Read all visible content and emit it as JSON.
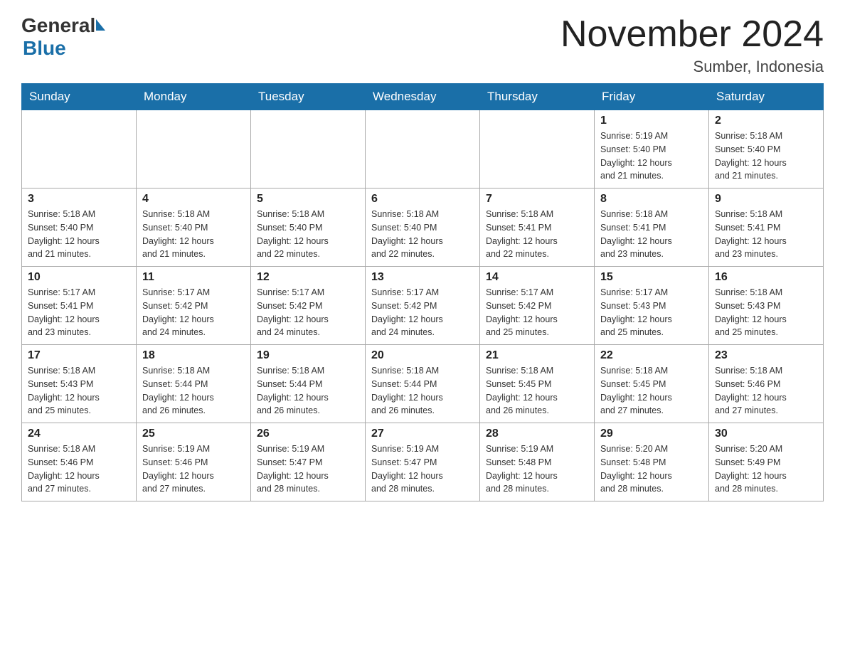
{
  "header": {
    "title": "November 2024",
    "location": "Sumber, Indonesia",
    "logo_general": "General",
    "logo_blue": "Blue"
  },
  "days_of_week": [
    "Sunday",
    "Monday",
    "Tuesday",
    "Wednesday",
    "Thursday",
    "Friday",
    "Saturday"
  ],
  "weeks": [
    [
      {
        "day": "",
        "info": ""
      },
      {
        "day": "",
        "info": ""
      },
      {
        "day": "",
        "info": ""
      },
      {
        "day": "",
        "info": ""
      },
      {
        "day": "",
        "info": ""
      },
      {
        "day": "1",
        "info": "Sunrise: 5:19 AM\nSunset: 5:40 PM\nDaylight: 12 hours\nand 21 minutes."
      },
      {
        "day": "2",
        "info": "Sunrise: 5:18 AM\nSunset: 5:40 PM\nDaylight: 12 hours\nand 21 minutes."
      }
    ],
    [
      {
        "day": "3",
        "info": "Sunrise: 5:18 AM\nSunset: 5:40 PM\nDaylight: 12 hours\nand 21 minutes."
      },
      {
        "day": "4",
        "info": "Sunrise: 5:18 AM\nSunset: 5:40 PM\nDaylight: 12 hours\nand 21 minutes."
      },
      {
        "day": "5",
        "info": "Sunrise: 5:18 AM\nSunset: 5:40 PM\nDaylight: 12 hours\nand 22 minutes."
      },
      {
        "day": "6",
        "info": "Sunrise: 5:18 AM\nSunset: 5:40 PM\nDaylight: 12 hours\nand 22 minutes."
      },
      {
        "day": "7",
        "info": "Sunrise: 5:18 AM\nSunset: 5:41 PM\nDaylight: 12 hours\nand 22 minutes."
      },
      {
        "day": "8",
        "info": "Sunrise: 5:18 AM\nSunset: 5:41 PM\nDaylight: 12 hours\nand 23 minutes."
      },
      {
        "day": "9",
        "info": "Sunrise: 5:18 AM\nSunset: 5:41 PM\nDaylight: 12 hours\nand 23 minutes."
      }
    ],
    [
      {
        "day": "10",
        "info": "Sunrise: 5:17 AM\nSunset: 5:41 PM\nDaylight: 12 hours\nand 23 minutes."
      },
      {
        "day": "11",
        "info": "Sunrise: 5:17 AM\nSunset: 5:42 PM\nDaylight: 12 hours\nand 24 minutes."
      },
      {
        "day": "12",
        "info": "Sunrise: 5:17 AM\nSunset: 5:42 PM\nDaylight: 12 hours\nand 24 minutes."
      },
      {
        "day": "13",
        "info": "Sunrise: 5:17 AM\nSunset: 5:42 PM\nDaylight: 12 hours\nand 24 minutes."
      },
      {
        "day": "14",
        "info": "Sunrise: 5:17 AM\nSunset: 5:42 PM\nDaylight: 12 hours\nand 25 minutes."
      },
      {
        "day": "15",
        "info": "Sunrise: 5:17 AM\nSunset: 5:43 PM\nDaylight: 12 hours\nand 25 minutes."
      },
      {
        "day": "16",
        "info": "Sunrise: 5:18 AM\nSunset: 5:43 PM\nDaylight: 12 hours\nand 25 minutes."
      }
    ],
    [
      {
        "day": "17",
        "info": "Sunrise: 5:18 AM\nSunset: 5:43 PM\nDaylight: 12 hours\nand 25 minutes."
      },
      {
        "day": "18",
        "info": "Sunrise: 5:18 AM\nSunset: 5:44 PM\nDaylight: 12 hours\nand 26 minutes."
      },
      {
        "day": "19",
        "info": "Sunrise: 5:18 AM\nSunset: 5:44 PM\nDaylight: 12 hours\nand 26 minutes."
      },
      {
        "day": "20",
        "info": "Sunrise: 5:18 AM\nSunset: 5:44 PM\nDaylight: 12 hours\nand 26 minutes."
      },
      {
        "day": "21",
        "info": "Sunrise: 5:18 AM\nSunset: 5:45 PM\nDaylight: 12 hours\nand 26 minutes."
      },
      {
        "day": "22",
        "info": "Sunrise: 5:18 AM\nSunset: 5:45 PM\nDaylight: 12 hours\nand 27 minutes."
      },
      {
        "day": "23",
        "info": "Sunrise: 5:18 AM\nSunset: 5:46 PM\nDaylight: 12 hours\nand 27 minutes."
      }
    ],
    [
      {
        "day": "24",
        "info": "Sunrise: 5:18 AM\nSunset: 5:46 PM\nDaylight: 12 hours\nand 27 minutes."
      },
      {
        "day": "25",
        "info": "Sunrise: 5:19 AM\nSunset: 5:46 PM\nDaylight: 12 hours\nand 27 minutes."
      },
      {
        "day": "26",
        "info": "Sunrise: 5:19 AM\nSunset: 5:47 PM\nDaylight: 12 hours\nand 28 minutes."
      },
      {
        "day": "27",
        "info": "Sunrise: 5:19 AM\nSunset: 5:47 PM\nDaylight: 12 hours\nand 28 minutes."
      },
      {
        "day": "28",
        "info": "Sunrise: 5:19 AM\nSunset: 5:48 PM\nDaylight: 12 hours\nand 28 minutes."
      },
      {
        "day": "29",
        "info": "Sunrise: 5:20 AM\nSunset: 5:48 PM\nDaylight: 12 hours\nand 28 minutes."
      },
      {
        "day": "30",
        "info": "Sunrise: 5:20 AM\nSunset: 5:49 PM\nDaylight: 12 hours\nand 28 minutes."
      }
    ]
  ]
}
